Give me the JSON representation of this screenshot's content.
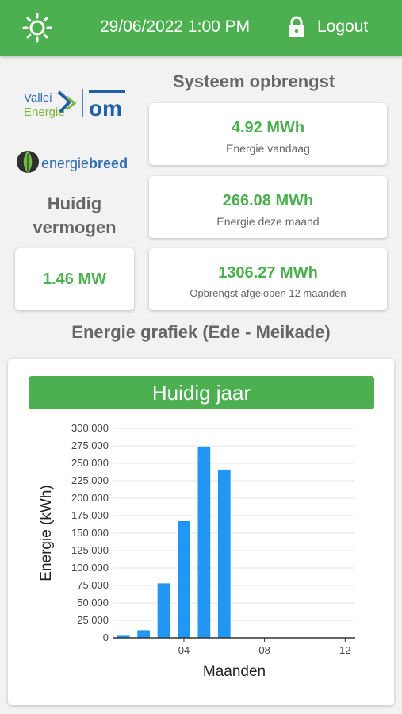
{
  "header": {
    "datetime": "29/06/2022 1:00 PM",
    "logout_label": "Logout",
    "icons": [
      "sun-icon",
      "lock-icon"
    ],
    "color": "#4caf50"
  },
  "logos": {
    "vallei_line1": "Vallei",
    "vallei_line2": "Energie",
    "vallei_mark": "om",
    "energiebreed_part1": "energie",
    "energiebreed_part2": "breed"
  },
  "system_output": {
    "title": "Systeem opbrengst",
    "today": {
      "value": "4.92 MWh",
      "label": "Energie vandaag"
    },
    "month": {
      "value": "266.08 MWh",
      "label": "Energie deze maand"
    },
    "year": {
      "value": "1306.27 MWh",
      "label": "Opbrengst afgelopen 12 maanden"
    }
  },
  "current_power": {
    "title_line1": "Huidig",
    "title_line2": "vermogen",
    "value": "1.46 MW"
  },
  "energy_chart": {
    "title": "Energie grafiek (Ede - Meikade)",
    "tab_label": "Huidig jaar"
  },
  "chart_data": {
    "type": "bar",
    "title": "Huidig jaar",
    "xlabel": "Maanden",
    "ylabel": "Energie (kWh)",
    "x": [
      1,
      2,
      3,
      4,
      5,
      6
    ],
    "values": [
      3000,
      11000,
      78000,
      167000,
      274000,
      241000
    ],
    "xlim": [
      0.5,
      12.5
    ],
    "x_ticks": [
      "04",
      "08",
      "12"
    ],
    "ylim": [
      0,
      300000
    ],
    "y_ticks": [
      "0",
      "25,000",
      "50,000",
      "75,000",
      "100,000",
      "125,000",
      "150,000",
      "175,000",
      "200,000",
      "225,000",
      "250,000",
      "275,000",
      "300,000"
    ],
    "bar_color": "#2196f3",
    "grid": true
  }
}
